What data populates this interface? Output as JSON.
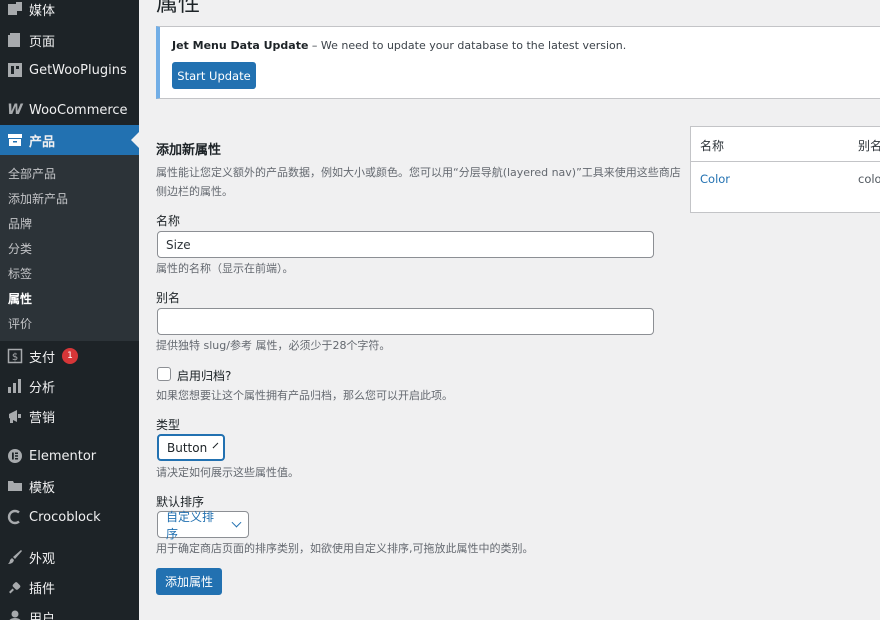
{
  "sidebar": {
    "items": [
      {
        "label": "媒体",
        "icon": "media-icon"
      },
      {
        "label": "页面",
        "icon": "page-icon"
      },
      {
        "label": "GetWooPlugins",
        "icon": "plugin-box-icon"
      },
      {
        "label": "WooCommerce",
        "icon": "woo-icon"
      },
      {
        "label": "产品",
        "icon": "archive-icon"
      },
      {
        "label": "支付",
        "icon": "payment-icon",
        "badge": "1"
      },
      {
        "label": "分析",
        "icon": "chart-icon"
      },
      {
        "label": "营销",
        "icon": "megaphone-icon"
      },
      {
        "label": "Elementor",
        "icon": "elementor-icon"
      },
      {
        "label": "模板",
        "icon": "folder-icon"
      },
      {
        "label": "Crocoblock",
        "icon": "crocoblock-icon"
      },
      {
        "label": "外观",
        "icon": "paintbrush-icon"
      },
      {
        "label": "插件",
        "icon": "plug-icon"
      },
      {
        "label": "用户",
        "icon": "user-icon"
      }
    ],
    "submenu": [
      "全部产品",
      "添加新产品",
      "品牌",
      "分类",
      "标签",
      "属性",
      "评价"
    ]
  },
  "page": {
    "title": "属性"
  },
  "notice": {
    "title": "Jet Menu Data Update",
    "message": " – We need to update your database to the latest version.",
    "button": "Start Update"
  },
  "form": {
    "heading": "添加新属性",
    "description": "属性能让您定义额外的产品数据，例如大小或颜色。您可以用“分层导航(layered nav)”工具来使用这些商店侧边栏的属性。",
    "name_label": "名称",
    "name_value": "Size",
    "name_help": "属性的名称（显示在前端）。",
    "slug_label": "别名",
    "slug_value": "",
    "slug_help": "提供独特 slug/参考 属性，必须少于28个字符。",
    "archive_label": "启用归档?",
    "archive_help": "如果您想要让这个属性拥有产品归档，那么您可以开启此项。",
    "type_label": "类型",
    "type_value": "Button",
    "type_help": "请决定如何展示这些属性值。",
    "order_label": "默认排序",
    "order_value": "自定义排序",
    "order_help": "用于确定商店页面的排序类别，如欲使用自定义排序,可拖放此属性中的类别。",
    "submit": "添加属性"
  },
  "table": {
    "headers": [
      "名称",
      "别名"
    ],
    "rows": [
      [
        "Color",
        "colo"
      ]
    ]
  },
  "colors": {
    "accent": "#2271b1",
    "sidebar": "#1d2327",
    "badge": "#d63638"
  }
}
